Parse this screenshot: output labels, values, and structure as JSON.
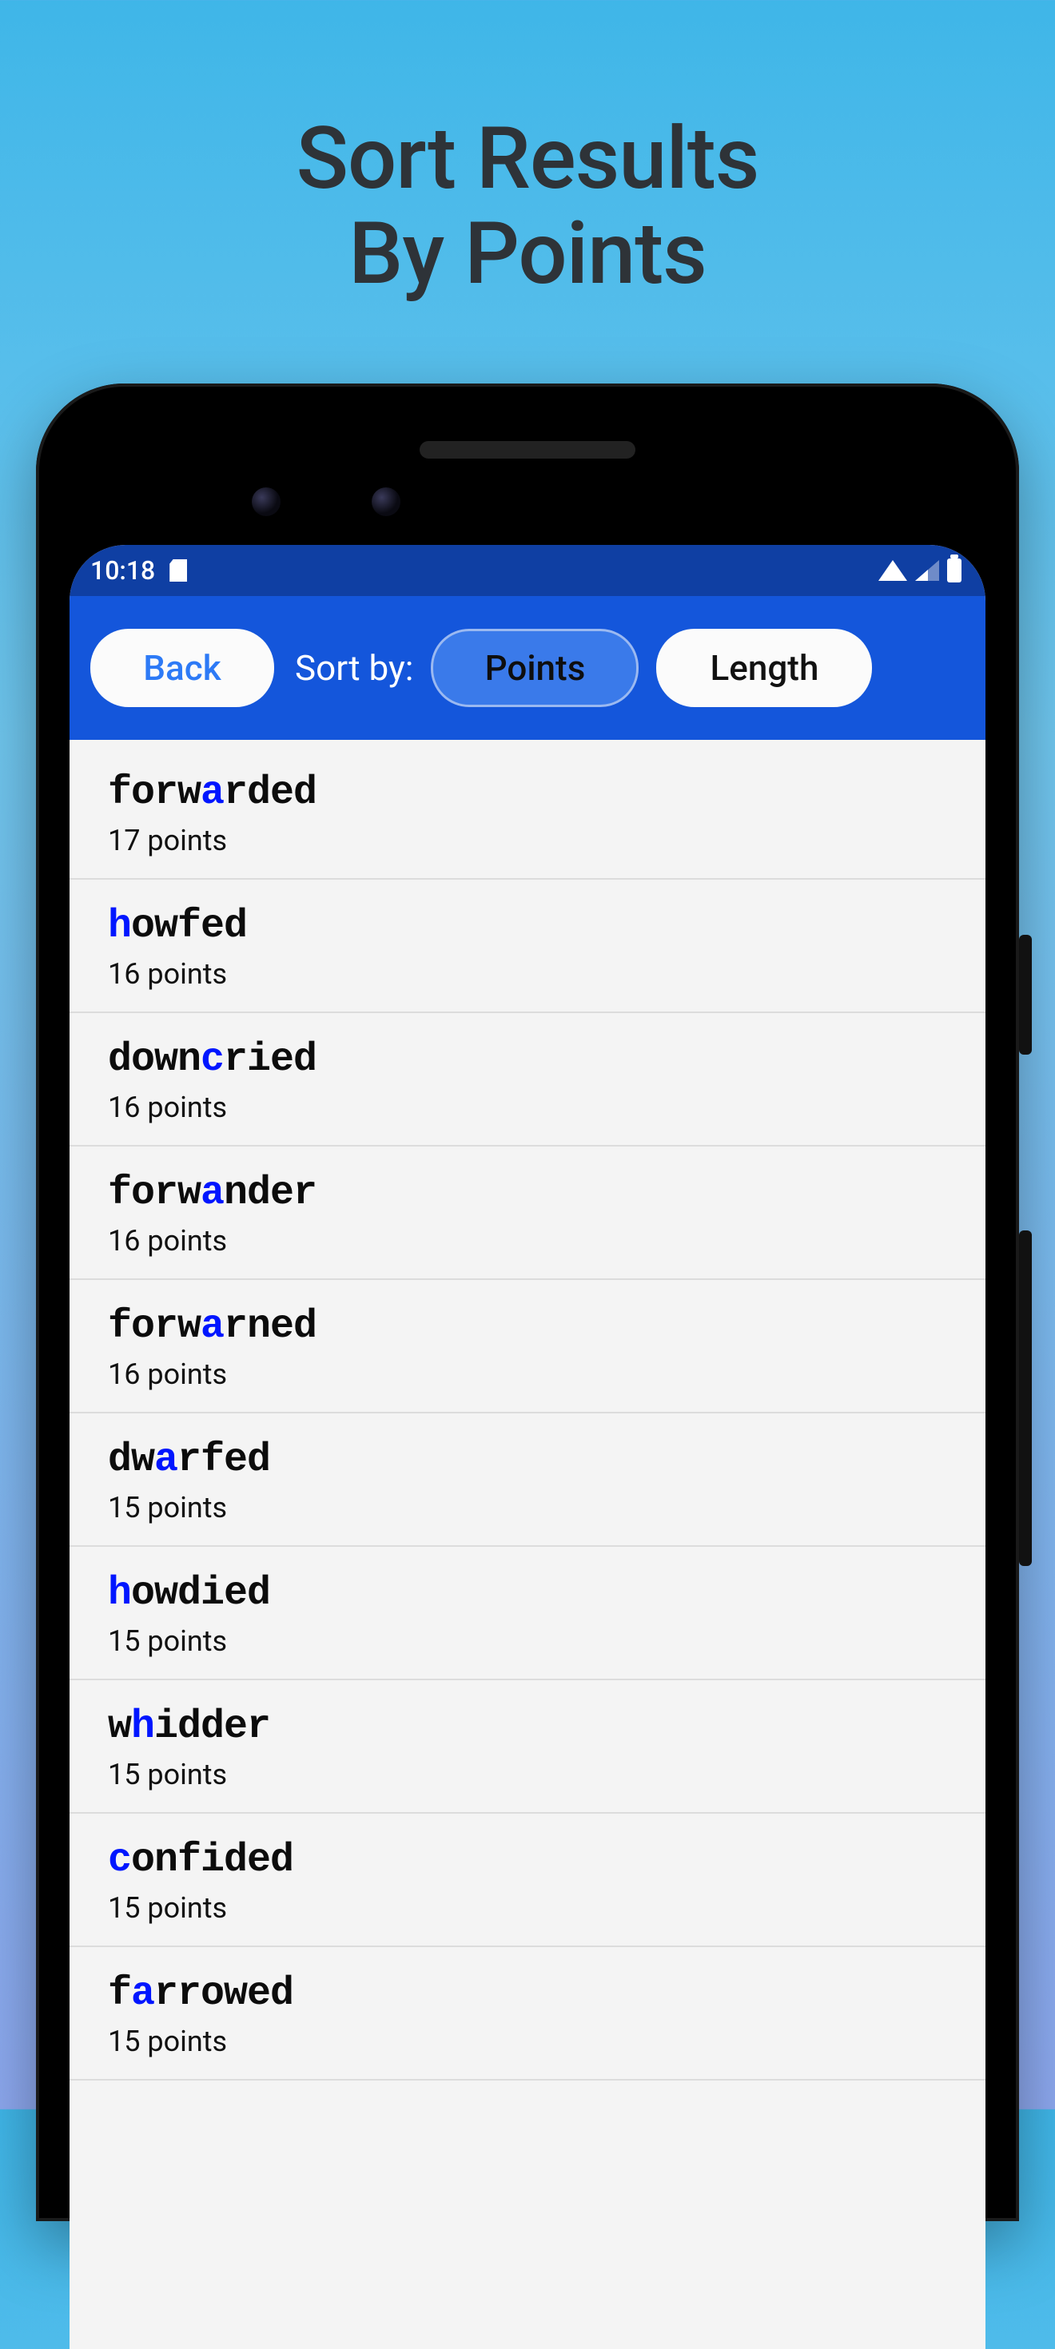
{
  "promo": {
    "line1": "Sort Results",
    "line2": "By Points"
  },
  "status": {
    "time": "10:18"
  },
  "toolbar": {
    "back": "Back",
    "sort_label": "Sort by:",
    "points": "Points",
    "length": "Length"
  },
  "points_suffix": "points",
  "results": [
    {
      "word": "forwarded",
      "hl": [
        4
      ],
      "points": 17
    },
    {
      "word": "howfed",
      "hl": [
        0
      ],
      "points": 16
    },
    {
      "word": "downcried",
      "hl": [
        4
      ],
      "points": 16
    },
    {
      "word": "forwander",
      "hl": [
        4
      ],
      "points": 16
    },
    {
      "word": "forwarned",
      "hl": [
        4
      ],
      "points": 16
    },
    {
      "word": "dwarfed",
      "hl": [
        2
      ],
      "points": 15
    },
    {
      "word": "howdied",
      "hl": [
        0
      ],
      "points": 15
    },
    {
      "word": "whidder",
      "hl": [
        1
      ],
      "points": 15
    },
    {
      "word": "confided",
      "hl": [
        0
      ],
      "points": 15
    },
    {
      "word": "farrowed",
      "hl": [
        1
      ],
      "points": 15
    }
  ]
}
